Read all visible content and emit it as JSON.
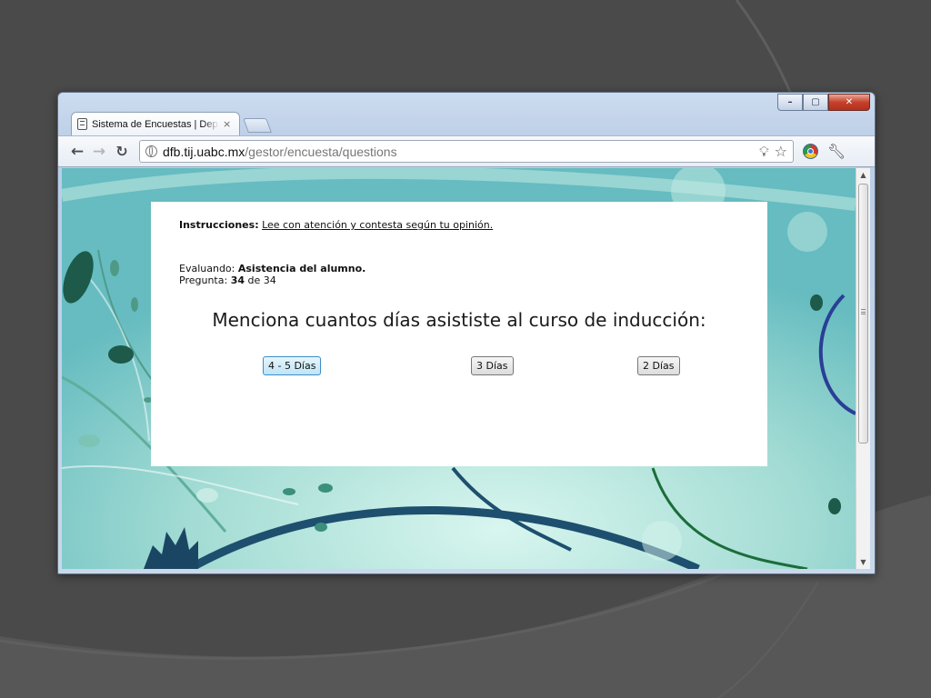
{
  "browser": {
    "tab_title": "Sistema de Encuestas | Departamento",
    "tab_close": "×",
    "url_host": "dfb.tij.uabc.mx",
    "url_path": "/gestor/encuesta/questions"
  },
  "icons": {
    "back": "back-arrow-icon",
    "forward": "forward-arrow-icon",
    "reload": "reload-icon",
    "page": "globe-icon",
    "bulb": "bulb-icon",
    "star": "star-icon",
    "extension": "chrome-extension-icon",
    "wrench": "wrench-icon"
  },
  "survey": {
    "instructions_label": "Instrucciones:",
    "instructions_text": "Lee con atención y contesta según tu opinión.",
    "evaluating_label": "Evaluando:",
    "evaluating_value": "Asistencia del alumno.",
    "question_label": "Pregunta:",
    "question_number": "34",
    "question_of": "de 34",
    "question_text": "Menciona cuantos días asististe al curso de inducción:",
    "options": [
      "4 - 5 Días",
      "3 Días",
      "2 Días"
    ]
  },
  "colors": {
    "desktop": "#4a4a4a",
    "page_background": "#a8dcd6",
    "selected_option_border": "#3c8fc7"
  }
}
